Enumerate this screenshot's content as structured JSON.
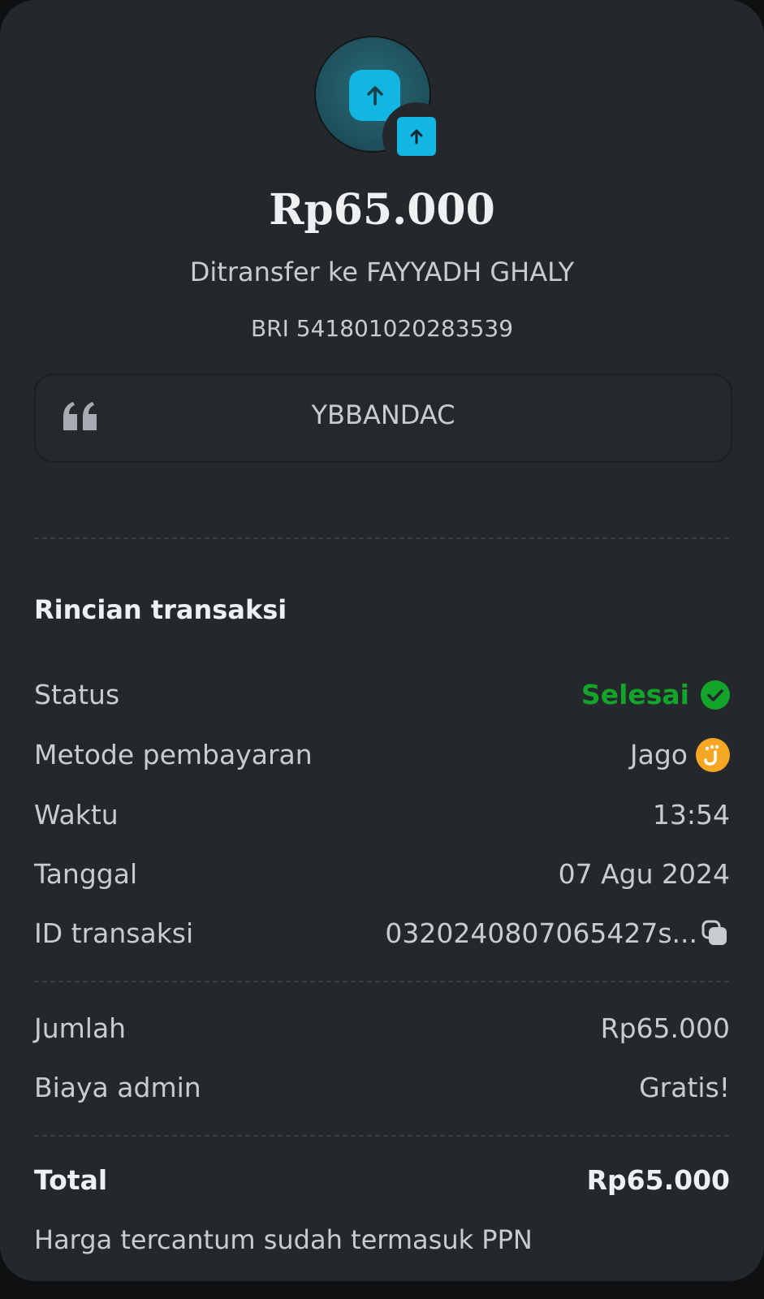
{
  "header": {
    "amount": "Rp65.000",
    "recipient": "Ditransfer ke FAYYADH GHALY",
    "account": "BRI 541801020283539",
    "avatar_icon": "arrow-up-icon",
    "badge_icon": "arrow-up-icon",
    "accent_color": "#11b6e2"
  },
  "note": {
    "icon": "quote-icon",
    "text": "YBBANDAC"
  },
  "details": {
    "title": "Rincian transaksi",
    "status": {
      "label": "Status",
      "value": "Selesai",
      "icon": "check-circle-icon",
      "color": "#12a52a"
    },
    "method": {
      "label": "Metode pembayaran",
      "value": "Jago",
      "icon": "jago-logo-icon",
      "color": "#f5a623"
    },
    "time": {
      "label": "Waktu",
      "value": "13:54"
    },
    "date": {
      "label": "Tanggal",
      "value": "07 Agu 2024"
    },
    "txid": {
      "label": "ID transaksi",
      "value": "0320240807065427s...",
      "icon": "copy-icon"
    }
  },
  "summary": {
    "amount": {
      "label": "Jumlah",
      "value": "Rp65.000"
    },
    "fee": {
      "label": "Biaya admin",
      "value": "Gratis!"
    }
  },
  "total": {
    "label": "Total",
    "value": "Rp65.000"
  },
  "footnote": "Harga tercantum sudah termasuk PPN"
}
